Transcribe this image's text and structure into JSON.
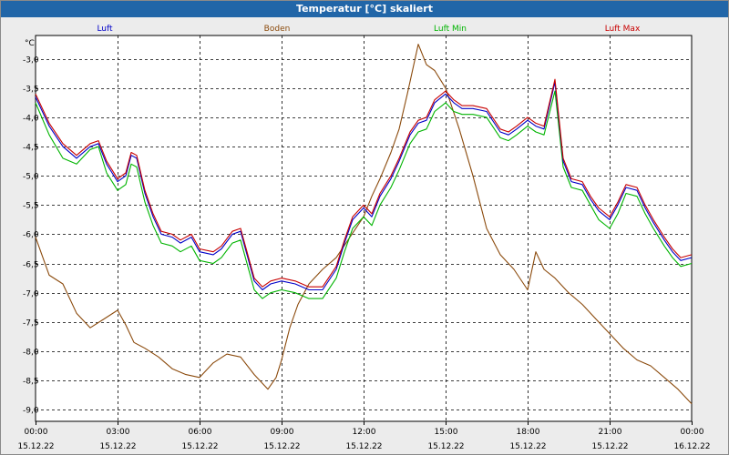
{
  "window": {
    "title": "Temperatur [°C] skaliert"
  },
  "chart_data": {
    "type": "line",
    "title": "Temperatur [°C] skaliert",
    "ylabel": "°C",
    "xlabel": "",
    "ylim": [
      -9.2,
      -2.6
    ],
    "y_ticks": [
      -3.0,
      -3.5,
      -4.0,
      -4.5,
      -5.0,
      -5.5,
      -6.0,
      -6.5,
      -7.0,
      -7.5,
      -8.0,
      -8.5,
      -9.0
    ],
    "y_tick_labels": [
      "-3,0",
      "-3,5",
      "-4,0",
      "-4,5",
      "-5,0",
      "-5,5",
      "-6,0",
      "-6,5",
      "-7,0",
      "-7,5",
      "-8,0",
      "-8,5",
      "-9,0"
    ],
    "x_ticks": [
      {
        "time": "00:00",
        "date": "15.12.22"
      },
      {
        "time": "03:00",
        "date": "15.12.22"
      },
      {
        "time": "06:00",
        "date": "15.12.22"
      },
      {
        "time": "09:00",
        "date": "15.12.22"
      },
      {
        "time": "12:00",
        "date": "15.12.22"
      },
      {
        "time": "15:00",
        "date": "15.12.22"
      },
      {
        "time": "18:00",
        "date": "15.12.22"
      },
      {
        "time": "21:00",
        "date": "15.12.22"
      },
      {
        "time": "00:00",
        "date": "16.12.22"
      }
    ],
    "grid": true,
    "legend_position": "top",
    "series": [
      {
        "name": "Luft",
        "color": "#0000c8",
        "points": [
          [
            0,
            -3.65
          ],
          [
            0.5,
            -4.15
          ],
          [
            1,
            -4.5
          ],
          [
            1.5,
            -4.7
          ],
          [
            2,
            -4.5
          ],
          [
            2.3,
            -4.45
          ],
          [
            2.6,
            -4.8
          ],
          [
            3,
            -5.1
          ],
          [
            3.3,
            -5.0
          ],
          [
            3.5,
            -4.65
          ],
          [
            3.7,
            -4.7
          ],
          [
            4,
            -5.3
          ],
          [
            4.3,
            -5.7
          ],
          [
            4.6,
            -6.0
          ],
          [
            5,
            -6.05
          ],
          [
            5.3,
            -6.15
          ],
          [
            5.7,
            -6.05
          ],
          [
            6,
            -6.3
          ],
          [
            6.5,
            -6.35
          ],
          [
            6.8,
            -6.25
          ],
          [
            7.2,
            -6.0
          ],
          [
            7.5,
            -5.95
          ],
          [
            8,
            -6.8
          ],
          [
            8.3,
            -6.95
          ],
          [
            8.6,
            -6.85
          ],
          [
            9,
            -6.8
          ],
          [
            9.5,
            -6.85
          ],
          [
            10,
            -6.95
          ],
          [
            10.5,
            -6.95
          ],
          [
            11,
            -6.6
          ],
          [
            11.3,
            -6.15
          ],
          [
            11.6,
            -5.75
          ],
          [
            12,
            -5.55
          ],
          [
            12.3,
            -5.7
          ],
          [
            12.6,
            -5.35
          ],
          [
            13,
            -5.05
          ],
          [
            13.3,
            -4.75
          ],
          [
            13.7,
            -4.3
          ],
          [
            14,
            -4.1
          ],
          [
            14.3,
            -4.05
          ],
          [
            14.6,
            -3.75
          ],
          [
            15,
            -3.6
          ],
          [
            15.3,
            -3.75
          ],
          [
            15.6,
            -3.85
          ],
          [
            16,
            -3.85
          ],
          [
            16.5,
            -3.9
          ],
          [
            17,
            -4.25
          ],
          [
            17.3,
            -4.3
          ],
          [
            17.6,
            -4.2
          ],
          [
            18,
            -4.05
          ],
          [
            18.3,
            -4.15
          ],
          [
            18.6,
            -4.2
          ],
          [
            19,
            -3.4
          ],
          [
            19.3,
            -4.75
          ],
          [
            19.6,
            -5.1
          ],
          [
            20,
            -5.15
          ],
          [
            20.3,
            -5.4
          ],
          [
            20.6,
            -5.6
          ],
          [
            21,
            -5.75
          ],
          [
            21.3,
            -5.5
          ],
          [
            21.6,
            -5.2
          ],
          [
            22,
            -5.25
          ],
          [
            22.3,
            -5.55
          ],
          [
            22.6,
            -5.8
          ],
          [
            23,
            -6.1
          ],
          [
            23.3,
            -6.3
          ],
          [
            23.6,
            -6.45
          ],
          [
            24,
            -6.4
          ]
        ]
      },
      {
        "name": "Boden",
        "color": "#8b4a0c",
        "points": [
          [
            0,
            -6.05
          ],
          [
            0.5,
            -6.7
          ],
          [
            1,
            -6.85
          ],
          [
            1.5,
            -7.35
          ],
          [
            2,
            -7.6
          ],
          [
            2.5,
            -7.45
          ],
          [
            3,
            -7.3
          ],
          [
            3.3,
            -7.55
          ],
          [
            3.6,
            -7.85
          ],
          [
            4,
            -7.95
          ],
          [
            4.5,
            -8.1
          ],
          [
            5,
            -8.3
          ],
          [
            5.5,
            -8.4
          ],
          [
            6,
            -8.45
          ],
          [
            6.5,
            -8.2
          ],
          [
            7,
            -8.05
          ],
          [
            7.5,
            -8.1
          ],
          [
            8,
            -8.4
          ],
          [
            8.5,
            -8.65
          ],
          [
            8.8,
            -8.45
          ],
          [
            9,
            -8.15
          ],
          [
            9.3,
            -7.6
          ],
          [
            9.6,
            -7.2
          ],
          [
            10,
            -6.85
          ],
          [
            10.5,
            -6.6
          ],
          [
            11,
            -6.4
          ],
          [
            11.5,
            -6.05
          ],
          [
            12,
            -5.7
          ],
          [
            12.3,
            -5.35
          ],
          [
            12.6,
            -5.05
          ],
          [
            13,
            -4.6
          ],
          [
            13.3,
            -4.2
          ],
          [
            13.6,
            -3.6
          ],
          [
            14,
            -2.75
          ],
          [
            14.3,
            -3.1
          ],
          [
            14.6,
            -3.2
          ],
          [
            15,
            -3.5
          ],
          [
            15.5,
            -4.2
          ],
          [
            16,
            -5.0
          ],
          [
            16.5,
            -5.9
          ],
          [
            17,
            -6.35
          ],
          [
            17.5,
            -6.6
          ],
          [
            18,
            -6.95
          ],
          [
            18.3,
            -6.3
          ],
          [
            18.6,
            -6.6
          ],
          [
            19,
            -6.75
          ],
          [
            19.5,
            -7.0
          ],
          [
            20,
            -7.2
          ],
          [
            20.5,
            -7.45
          ],
          [
            21,
            -7.7
          ],
          [
            21.5,
            -7.95
          ],
          [
            22,
            -8.15
          ],
          [
            22.5,
            -8.25
          ],
          [
            23,
            -8.45
          ],
          [
            23.5,
            -8.65
          ],
          [
            24,
            -8.9
          ]
        ]
      },
      {
        "name": "Luft Min",
        "color": "#00b400",
        "points": [
          [
            0,
            -3.75
          ],
          [
            0.5,
            -4.3
          ],
          [
            1,
            -4.7
          ],
          [
            1.5,
            -4.8
          ],
          [
            2,
            -4.55
          ],
          [
            2.3,
            -4.5
          ],
          [
            2.6,
            -4.95
          ],
          [
            3,
            -5.25
          ],
          [
            3.3,
            -5.15
          ],
          [
            3.5,
            -4.8
          ],
          [
            3.7,
            -4.85
          ],
          [
            4,
            -5.45
          ],
          [
            4.3,
            -5.85
          ],
          [
            4.6,
            -6.15
          ],
          [
            5,
            -6.2
          ],
          [
            5.3,
            -6.3
          ],
          [
            5.7,
            -6.2
          ],
          [
            6,
            -6.45
          ],
          [
            6.5,
            -6.5
          ],
          [
            6.8,
            -6.4
          ],
          [
            7.2,
            -6.15
          ],
          [
            7.5,
            -6.1
          ],
          [
            8,
            -6.95
          ],
          [
            8.3,
            -7.1
          ],
          [
            8.6,
            -7.0
          ],
          [
            9,
            -6.95
          ],
          [
            9.5,
            -7.0
          ],
          [
            10,
            -7.1
          ],
          [
            10.5,
            -7.1
          ],
          [
            11,
            -6.75
          ],
          [
            11.3,
            -6.3
          ],
          [
            11.6,
            -5.9
          ],
          [
            12,
            -5.7
          ],
          [
            12.3,
            -5.85
          ],
          [
            12.6,
            -5.5
          ],
          [
            13,
            -5.2
          ],
          [
            13.3,
            -4.9
          ],
          [
            13.7,
            -4.45
          ],
          [
            14,
            -4.25
          ],
          [
            14.3,
            -4.2
          ],
          [
            14.6,
            -3.9
          ],
          [
            15,
            -3.75
          ],
          [
            15.3,
            -3.9
          ],
          [
            15.6,
            -3.95
          ],
          [
            16,
            -3.95
          ],
          [
            16.5,
            -4.0
          ],
          [
            17,
            -4.35
          ],
          [
            17.3,
            -4.4
          ],
          [
            17.6,
            -4.3
          ],
          [
            18,
            -4.15
          ],
          [
            18.3,
            -4.25
          ],
          [
            18.6,
            -4.3
          ],
          [
            19,
            -3.55
          ],
          [
            19.3,
            -4.85
          ],
          [
            19.6,
            -5.2
          ],
          [
            20,
            -5.25
          ],
          [
            20.3,
            -5.5
          ],
          [
            20.6,
            -5.75
          ],
          [
            21,
            -5.9
          ],
          [
            21.3,
            -5.65
          ],
          [
            21.6,
            -5.3
          ],
          [
            22,
            -5.35
          ],
          [
            22.3,
            -5.65
          ],
          [
            22.6,
            -5.9
          ],
          [
            23,
            -6.2
          ],
          [
            23.3,
            -6.4
          ],
          [
            23.6,
            -6.55
          ],
          [
            24,
            -6.5
          ]
        ]
      },
      {
        "name": "Luft Max",
        "color": "#c80000",
        "points": [
          [
            0,
            -3.6
          ],
          [
            0.5,
            -4.1
          ],
          [
            1,
            -4.45
          ],
          [
            1.5,
            -4.65
          ],
          [
            2,
            -4.45
          ],
          [
            2.3,
            -4.4
          ],
          [
            2.6,
            -4.75
          ],
          [
            3,
            -5.05
          ],
          [
            3.3,
            -4.95
          ],
          [
            3.5,
            -4.6
          ],
          [
            3.7,
            -4.65
          ],
          [
            4,
            -5.25
          ],
          [
            4.3,
            -5.65
          ],
          [
            4.6,
            -5.95
          ],
          [
            5,
            -6.0
          ],
          [
            5.3,
            -6.1
          ],
          [
            5.7,
            -6.0
          ],
          [
            6,
            -6.25
          ],
          [
            6.5,
            -6.3
          ],
          [
            6.8,
            -6.2
          ],
          [
            7.2,
            -5.95
          ],
          [
            7.5,
            -5.9
          ],
          [
            8,
            -6.75
          ],
          [
            8.3,
            -6.9
          ],
          [
            8.6,
            -6.8
          ],
          [
            9,
            -6.75
          ],
          [
            9.5,
            -6.8
          ],
          [
            10,
            -6.9
          ],
          [
            10.5,
            -6.9
          ],
          [
            11,
            -6.55
          ],
          [
            11.3,
            -6.1
          ],
          [
            11.6,
            -5.7
          ],
          [
            12,
            -5.5
          ],
          [
            12.3,
            -5.65
          ],
          [
            12.6,
            -5.3
          ],
          [
            13,
            -5.0
          ],
          [
            13.3,
            -4.7
          ],
          [
            13.7,
            -4.25
          ],
          [
            14,
            -4.05
          ],
          [
            14.3,
            -4.0
          ],
          [
            14.6,
            -3.7
          ],
          [
            15,
            -3.55
          ],
          [
            15.3,
            -3.7
          ],
          [
            15.6,
            -3.8
          ],
          [
            16,
            -3.8
          ],
          [
            16.5,
            -3.85
          ],
          [
            17,
            -4.2
          ],
          [
            17.3,
            -4.25
          ],
          [
            17.6,
            -4.15
          ],
          [
            18,
            -4.0
          ],
          [
            18.3,
            -4.1
          ],
          [
            18.6,
            -4.15
          ],
          [
            19,
            -3.35
          ],
          [
            19.3,
            -4.7
          ],
          [
            19.6,
            -5.05
          ],
          [
            20,
            -5.1
          ],
          [
            20.3,
            -5.35
          ],
          [
            20.6,
            -5.55
          ],
          [
            21,
            -5.7
          ],
          [
            21.3,
            -5.45
          ],
          [
            21.6,
            -5.15
          ],
          [
            22,
            -5.2
          ],
          [
            22.3,
            -5.5
          ],
          [
            22.6,
            -5.75
          ],
          [
            23,
            -6.05
          ],
          [
            23.3,
            -6.25
          ],
          [
            23.6,
            -6.4
          ],
          [
            24,
            -6.35
          ]
        ]
      }
    ]
  }
}
